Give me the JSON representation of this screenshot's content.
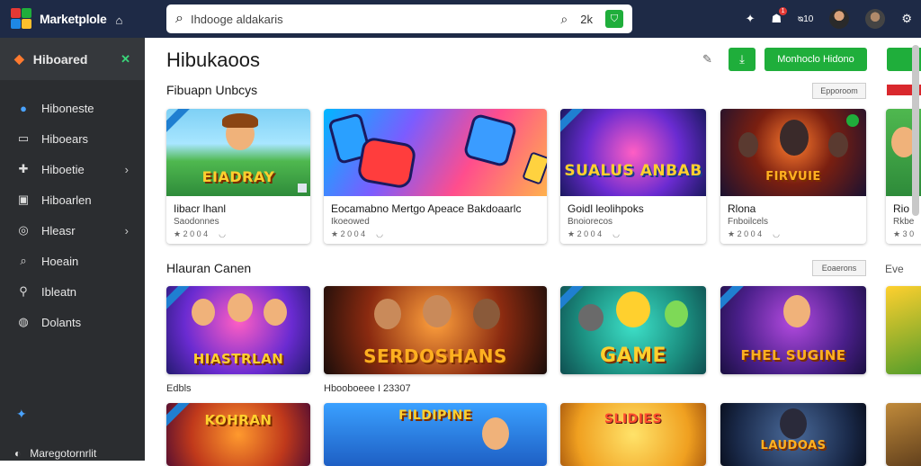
{
  "app": {
    "brand": "Marketplole",
    "search_value": "Ihdooge aldakaris",
    "search_zoom": "2k"
  },
  "icons": {
    "brand_logo": "multicolor-cube-icon",
    "brand_secondary": "home-icon",
    "search": "search-icon",
    "search_clear": "search-icon",
    "search_go": "shield-icon",
    "pin": "pin-icon",
    "notify": "bell-icon",
    "grid": "apps-icon",
    "gear": "gear-icon"
  },
  "topbar": {
    "badge_count": "1",
    "mini_label": "ᴓ10"
  },
  "sidebar": {
    "header": "Hiboared",
    "items": [
      {
        "label": "Hiboneste",
        "icon": "circle-icon",
        "chevron": false
      },
      {
        "label": "Hiboears",
        "icon": "monitor-icon",
        "chevron": false
      },
      {
        "label": "Hiboetie",
        "icon": "gamepad-icon",
        "chevron": true
      },
      {
        "label": "Hiboarlen",
        "icon": "card-icon",
        "chevron": false
      },
      {
        "label": "Hleasr",
        "icon": "compass-icon",
        "chevron": true
      },
      {
        "label": "Hoeain",
        "icon": "search-icon",
        "chevron": false
      },
      {
        "label": "Ibleatn",
        "icon": "pin-icon",
        "chevron": false
      },
      {
        "label": "Dolants",
        "icon": "chat-icon",
        "chevron": false
      }
    ],
    "footer": "Maregotornrlit"
  },
  "main": {
    "title": "Hibukaoos",
    "btn_primary": "Monhoclo Hidono",
    "section1": {
      "title": "Fibuapn Unbcys",
      "button": "Epporoom",
      "cards": [
        {
          "thumb_word": "EIADRAY",
          "title": "Iibacr lhanl",
          "sub": "Saodonnes",
          "meta": "★ 2 0 0 4"
        },
        {
          "thumb_word": "",
          "title": "Eocamabno Mertgo Apeace Bakdoaarlc",
          "sub": "Ikoeowed",
          "meta": "★ 2 0 0 4"
        },
        {
          "thumb_word": "SUALUS ANBAB",
          "title": "Goidl leolihpoks",
          "sub": "Bnoiorecos",
          "meta": "★ 2 0 0 4"
        },
        {
          "thumb_word": "FIRVUIE",
          "title": "Rlona",
          "sub": "Fnboilcels",
          "meta": "★ 2 0 0 4"
        },
        {
          "thumb_word": "",
          "title": "Rio",
          "sub": "Rkbe",
          "meta": "★ 3 0"
        }
      ]
    },
    "section2": {
      "title": "Hlauran Canen",
      "button": "Eoaerons",
      "see_more": "Eve",
      "labels": [
        "Edbls",
        "Hbooboeee I 23307"
      ],
      "cards": [
        {
          "thumb_word": "HIASTRLAN"
        },
        {
          "thumb_word": "SERDOSHANS"
        },
        {
          "thumb_word": "GAME"
        },
        {
          "thumb_word": "FHEL SUGINE"
        },
        {
          "thumb_word": ""
        }
      ],
      "cards_row2": [
        {
          "thumb_word": "KOHRAN"
        },
        {
          "thumb_word": "FILDIPINE"
        },
        {
          "thumb_word": "SLIDIES"
        },
        {
          "thumb_word": "LAUDOAS"
        },
        {
          "thumb_word": ""
        }
      ]
    }
  },
  "colors": {
    "topbar": "#1e2a46",
    "sidebar": "#2b2d30",
    "accent_green": "#1fae3b",
    "accent_red": "#d9282d"
  }
}
